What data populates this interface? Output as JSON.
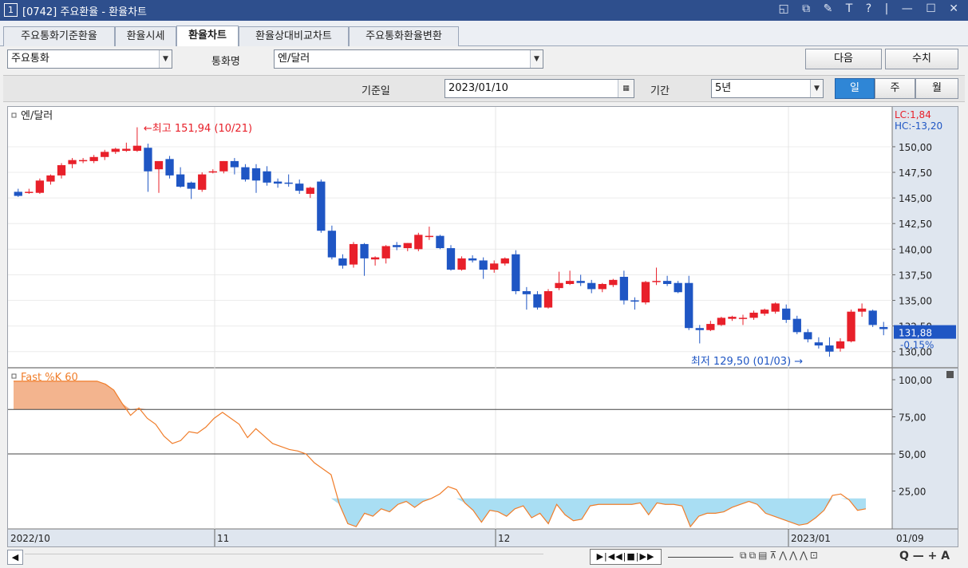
{
  "window": {
    "title_num": "1",
    "title": "[0742] 주요환율 - 환율차트",
    "controls": "◱ ⧉ ✎ T ? | — ☐ ✕"
  },
  "tabs": [
    {
      "label": "주요통화기준환율"
    },
    {
      "label": "환율시세"
    },
    {
      "label": "환율차트"
    },
    {
      "label": "환율상대비교차트"
    },
    {
      "label": "주요통화환율변환"
    }
  ],
  "toolbar": {
    "group_select": "주요통화",
    "currency_label": "통화명",
    "currency_select": "엔/달러",
    "next_button": "다음",
    "values_button": "수치",
    "base_date_label": "기준일",
    "base_date": "2023/01/10",
    "period_label": "기간",
    "period_select": "5년",
    "day_button": "일",
    "week_button": "주",
    "month_button": "월"
  },
  "colors": {
    "up": "#e8202a",
    "down": "#1f56c4",
    "accent": "#2f86d6",
    "stoch_line": "#f07d2a",
    "stoch_top": "#f3b48e",
    "stoch_bottom": "#a9def3"
  },
  "chart_data": {
    "type": "candlestick",
    "price_title": "엔/달러",
    "yticks": [
      "150,00",
      "147,50",
      "145,00",
      "142,50",
      "140,00",
      "137,50",
      "135,00",
      "132,50",
      "130,00"
    ],
    "ylim": [
      128.5,
      153.5
    ],
    "lc_label": "LC:1,84",
    "hc_label": "HC:-13,20",
    "last_price_label": "131,88",
    "last_change_label": "-0,15%",
    "high_annotation": "최고 151,94 (10/21)",
    "low_annotation": "최저 129,50 (01/03)",
    "x_labels": [
      "2022/10",
      "11",
      "12",
      "2023/01",
      "01/09"
    ],
    "candles": [
      {
        "o": 145.6,
        "h": 145.9,
        "c": 145.2,
        "l": 145.1
      },
      {
        "o": 145.6,
        "h": 145.9,
        "c": 145.6,
        "l": 145.4
      },
      {
        "o": 145.5,
        "h": 146.9,
        "c": 146.7,
        "l": 145.4
      },
      {
        "o": 146.6,
        "h": 147.3,
        "c": 147.2,
        "l": 146.3
      },
      {
        "o": 147.2,
        "h": 148.4,
        "c": 148.2,
        "l": 146.9
      },
      {
        "o": 148.3,
        "h": 148.9,
        "c": 148.7,
        "l": 147.9
      },
      {
        "o": 148.7,
        "h": 148.9,
        "c": 148.7,
        "l": 148.4
      },
      {
        "o": 148.6,
        "h": 149.2,
        "c": 149.0,
        "l": 148.4
      },
      {
        "o": 149.0,
        "h": 149.7,
        "c": 149.5,
        "l": 148.7
      },
      {
        "o": 149.5,
        "h": 149.9,
        "c": 149.8,
        "l": 149.3
      },
      {
        "o": 149.6,
        "h": 150.4,
        "c": 149.8,
        "l": 149.5
      },
      {
        "o": 149.6,
        "h": 151.9,
        "c": 150.1,
        "l": 149.5
      },
      {
        "o": 149.9,
        "h": 150.3,
        "c": 147.6,
        "l": 145.6
      },
      {
        "o": 147.8,
        "h": 148.5,
        "c": 148.6,
        "l": 145.5
      },
      {
        "o": 148.8,
        "h": 149.1,
        "c": 147.2,
        "l": 146.9
      },
      {
        "o": 147.3,
        "h": 148.0,
        "c": 146.1,
        "l": 146.0
      },
      {
        "o": 146.5,
        "h": 146.6,
        "c": 145.9,
        "l": 144.9
      },
      {
        "o": 145.8,
        "h": 147.5,
        "c": 147.3,
        "l": 145.6
      },
      {
        "o": 147.5,
        "h": 147.8,
        "c": 147.6,
        "l": 147.4
      },
      {
        "o": 147.6,
        "h": 148.6,
        "c": 148.6,
        "l": 147.4
      },
      {
        "o": 148.6,
        "h": 148.9,
        "c": 148.0,
        "l": 147.3
      },
      {
        "o": 148.0,
        "h": 148.3,
        "c": 146.8,
        "l": 146.6
      },
      {
        "o": 147.9,
        "h": 148.3,
        "c": 146.7,
        "l": 145.5
      },
      {
        "o": 147.6,
        "h": 148.1,
        "c": 146.5,
        "l": 146.2
      },
      {
        "o": 146.6,
        "h": 146.9,
        "c": 146.4,
        "l": 146.0
      },
      {
        "o": 146.5,
        "h": 147.3,
        "c": 146.4,
        "l": 146.1
      },
      {
        "o": 146.4,
        "h": 146.8,
        "c": 145.7,
        "l": 145.4
      },
      {
        "o": 145.4,
        "h": 146.1,
        "c": 146.0,
        "l": 145.0
      },
      {
        "o": 146.6,
        "h": 146.8,
        "c": 141.8,
        "l": 141.6
      },
      {
        "o": 141.8,
        "h": 142.3,
        "c": 139.2,
        "l": 139.0
      },
      {
        "o": 139.1,
        "h": 139.5,
        "c": 138.4,
        "l": 138.1
      },
      {
        "o": 138.5,
        "h": 140.7,
        "c": 140.5,
        "l": 138.2
      },
      {
        "o": 140.5,
        "h": 140.6,
        "c": 139.1,
        "l": 137.4
      },
      {
        "o": 139.0,
        "h": 139.3,
        "c": 139.2,
        "l": 138.4
      },
      {
        "o": 139.1,
        "h": 140.4,
        "c": 140.3,
        "l": 138.6
      },
      {
        "o": 140.4,
        "h": 140.7,
        "c": 140.2,
        "l": 139.9
      },
      {
        "o": 140.1,
        "h": 140.6,
        "c": 140.6,
        "l": 139.8
      },
      {
        "o": 140.0,
        "h": 141.6,
        "c": 141.4,
        "l": 139.8
      },
      {
        "o": 141.3,
        "h": 142.2,
        "c": 141.3,
        "l": 140.9
      },
      {
        "o": 141.3,
        "h": 141.4,
        "c": 140.1,
        "l": 140.0
      },
      {
        "o": 140.1,
        "h": 140.4,
        "c": 138.0,
        "l": 137.9
      },
      {
        "o": 138.0,
        "h": 139.3,
        "c": 139.1,
        "l": 137.9
      },
      {
        "o": 139.1,
        "h": 139.4,
        "c": 138.9,
        "l": 138.7
      },
      {
        "o": 138.9,
        "h": 139.2,
        "c": 138.0,
        "l": 137.1
      },
      {
        "o": 138.0,
        "h": 138.9,
        "c": 138.6,
        "l": 137.7
      },
      {
        "o": 138.6,
        "h": 139.2,
        "c": 139.1,
        "l": 138.4
      },
      {
        "o": 139.5,
        "h": 139.9,
        "c": 135.9,
        "l": 135.6
      },
      {
        "o": 135.9,
        "h": 136.3,
        "c": 135.6,
        "l": 134.1
      },
      {
        "o": 135.6,
        "h": 135.9,
        "c": 134.3,
        "l": 134.1
      },
      {
        "o": 134.3,
        "h": 136.1,
        "c": 135.9,
        "l": 134.2
      },
      {
        "o": 136.2,
        "h": 137.8,
        "c": 136.7,
        "l": 136.0
      },
      {
        "o": 136.6,
        "h": 137.9,
        "c": 136.9,
        "l": 136.5
      },
      {
        "o": 136.9,
        "h": 137.5,
        "c": 136.7,
        "l": 136.4
      },
      {
        "o": 136.7,
        "h": 137.0,
        "c": 136.1,
        "l": 135.7
      },
      {
        "o": 136.1,
        "h": 136.7,
        "c": 136.6,
        "l": 135.8
      },
      {
        "o": 136.5,
        "h": 137.1,
        "c": 137.0,
        "l": 136.3
      },
      {
        "o": 137.3,
        "h": 137.9,
        "c": 135.0,
        "l": 134.6
      },
      {
        "o": 135.0,
        "h": 135.3,
        "c": 134.9,
        "l": 134.1
      },
      {
        "o": 134.8,
        "h": 136.9,
        "c": 136.8,
        "l": 134.6
      },
      {
        "o": 136.9,
        "h": 138.2,
        "c": 136.9,
        "l": 136.5
      },
      {
        "o": 136.9,
        "h": 137.4,
        "c": 136.6,
        "l": 136.4
      },
      {
        "o": 136.7,
        "h": 136.9,
        "c": 135.8,
        "l": 135.7
      },
      {
        "o": 136.7,
        "h": 137.4,
        "c": 132.3,
        "l": 132.1
      },
      {
        "o": 132.3,
        "h": 132.6,
        "c": 132.1,
        "l": 130.8
      },
      {
        "o": 132.1,
        "h": 133.0,
        "c": 132.7,
        "l": 132.0
      },
      {
        "o": 132.6,
        "h": 133.4,
        "c": 133.3,
        "l": 132.5
      },
      {
        "o": 133.2,
        "h": 133.5,
        "c": 133.4,
        "l": 133.0
      },
      {
        "o": 133.2,
        "h": 133.6,
        "c": 133.3,
        "l": 132.6
      },
      {
        "o": 133.3,
        "h": 134.0,
        "c": 133.8,
        "l": 133.1
      },
      {
        "o": 133.7,
        "h": 134.2,
        "c": 134.1,
        "l": 133.5
      },
      {
        "o": 133.9,
        "h": 134.8,
        "c": 134.7,
        "l": 133.7
      },
      {
        "o": 134.2,
        "h": 134.6,
        "c": 133.1,
        "l": 132.8
      },
      {
        "o": 133.2,
        "h": 133.5,
        "c": 131.9,
        "l": 131.7
      },
      {
        "o": 131.9,
        "h": 132.2,
        "c": 131.2,
        "l": 130.9
      },
      {
        "o": 130.9,
        "h": 131.4,
        "c": 130.6,
        "l": 130.3
      },
      {
        "o": 130.6,
        "h": 131.4,
        "c": 130.0,
        "l": 129.5
      },
      {
        "o": 130.3,
        "h": 131.3,
        "c": 131.0,
        "l": 130.0
      },
      {
        "o": 131.0,
        "h": 134.1,
        "c": 133.9,
        "l": 130.9
      },
      {
        "o": 133.9,
        "h": 134.7,
        "c": 134.2,
        "l": 133.4
      },
      {
        "o": 134.0,
        "h": 134.1,
        "c": 132.6,
        "l": 132.4
      },
      {
        "o": 132.4,
        "h": 132.9,
        "c": 132.2,
        "l": 131.6
      }
    ],
    "stoch": {
      "title": "Fast %K 60",
      "yticks": [
        "100,00",
        "75,00",
        "50,00",
        "25,00"
      ],
      "upper": 80,
      "lower": 20,
      "values": [
        99,
        99,
        99,
        99,
        99,
        99,
        99,
        99,
        99,
        99,
        99,
        97,
        93,
        84,
        76,
        81,
        74,
        70,
        62,
        57,
        59,
        65,
        64,
        68,
        74,
        78,
        74,
        70,
        61,
        67,
        62,
        57,
        55,
        53,
        52,
        50,
        44,
        40,
        36,
        16,
        3,
        1,
        10,
        8,
        13,
        11,
        16,
        18,
        14,
        18,
        20,
        23,
        28,
        26,
        17,
        12,
        4,
        12,
        11,
        8,
        13,
        15,
        7,
        10,
        3,
        16,
        9,
        5,
        6,
        15,
        16,
        16,
        16,
        16,
        16,
        17,
        9,
        17,
        16,
        16,
        15,
        1,
        8,
        10,
        10,
        11,
        14,
        16,
        18,
        16,
        10,
        8,
        6,
        4,
        2,
        3,
        7,
        12,
        22,
        23,
        19,
        12,
        13
      ]
    }
  },
  "bottom": {
    "scroll_left": "◀",
    "tools": "▶|◀◀|■|▶▶",
    "zoom": "Q — + A"
  }
}
